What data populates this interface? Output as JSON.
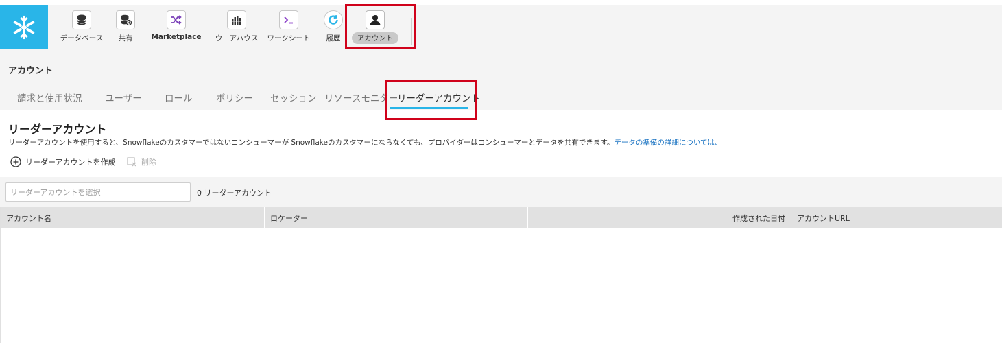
{
  "nav": {
    "items": [
      {
        "label": "データベース",
        "icon": "database-icon"
      },
      {
        "label": "共有",
        "icon": "shared-database-icon"
      },
      {
        "label": "Marketplace",
        "icon": "marketplace-shuffle-icon"
      },
      {
        "label": "ウエアハウス",
        "icon": "warehouse-icon"
      },
      {
        "label": "ワークシート",
        "icon": "terminal-icon"
      },
      {
        "label": "履歴",
        "icon": "history-refresh-icon"
      },
      {
        "label": "アカウント",
        "icon": "account-user-icon"
      }
    ]
  },
  "page": {
    "title": "アカウント"
  },
  "tabs": [
    {
      "label": "請求と使用状況"
    },
    {
      "label": "ユーザー"
    },
    {
      "label": "ロール"
    },
    {
      "label": "ポリシー"
    },
    {
      "label": "セッション"
    },
    {
      "label": "リソースモニター"
    },
    {
      "label": "リーダーアカウント"
    }
  ],
  "section": {
    "title": "リーダーアカウント",
    "description": "リーダーアカウントを使用すると、Snowflakeのカスタマーではないコンシューマーが Snowflakeのカスタマーにならなくても、プロバイダーはコンシューマーとデータを共有できます。",
    "link": "データの準備の詳細については、"
  },
  "actions": {
    "create_label": "リーダーアカウントを作成",
    "delete_label": "削除"
  },
  "filter": {
    "placeholder": "リーダーアカウントを選択",
    "count_text": "0 リーダーアカウント"
  },
  "table": {
    "columns": [
      "アカウント名",
      "ロケーター",
      "作成された日付",
      "アカウントURL"
    ],
    "rows": []
  },
  "colors": {
    "brand": "#29b5e8",
    "highlight": "#d0021b",
    "link": "#1a73c2"
  }
}
